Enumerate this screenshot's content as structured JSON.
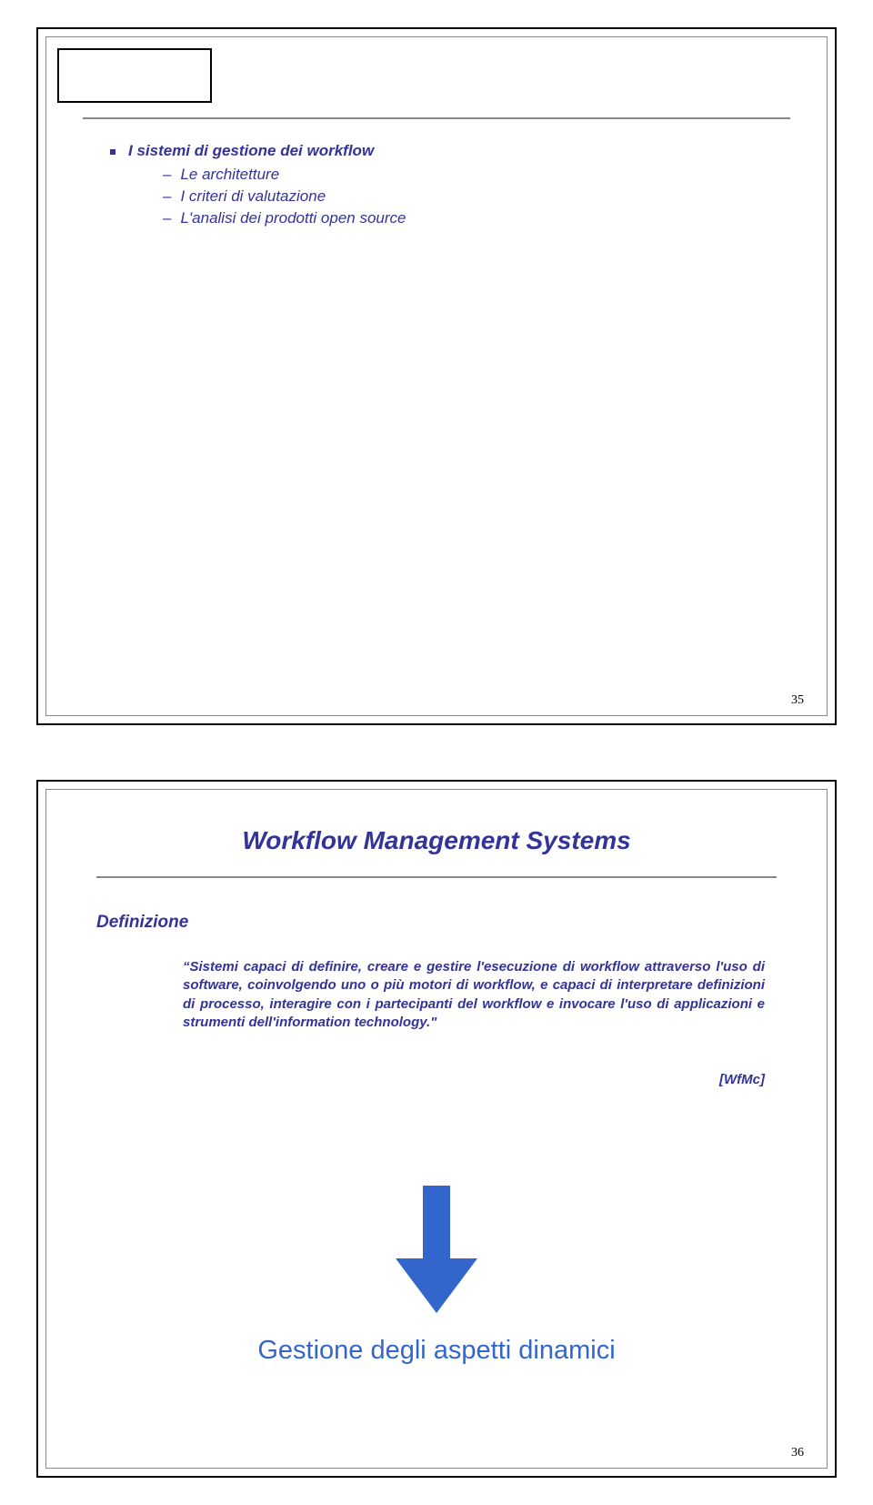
{
  "slide1": {
    "root": "I sistemi di gestione dei workflow",
    "items": [
      "Le architetture",
      "I criteri di valutazione",
      "L'analisi dei prodotti open source"
    ],
    "page_number": "35"
  },
  "slide2": {
    "title": "Workflow Management Systems",
    "section_label": "Definizione",
    "body": "“Sistemi capaci di definire, creare e gestire l'esecuzione di workflow attraverso l'uso di software, coinvolgendo uno o più motori di workflow, e capaci di interpretare definizioni di processo, interagire con i partecipanti del workflow e invocare l'uso di applicazioni e strumenti dell'information technology.\"",
    "citation": "[WfMc]",
    "conclusion": "Gestione degli aspetti dinamici",
    "arrow_color": "#3366cc",
    "page_number": "36"
  }
}
